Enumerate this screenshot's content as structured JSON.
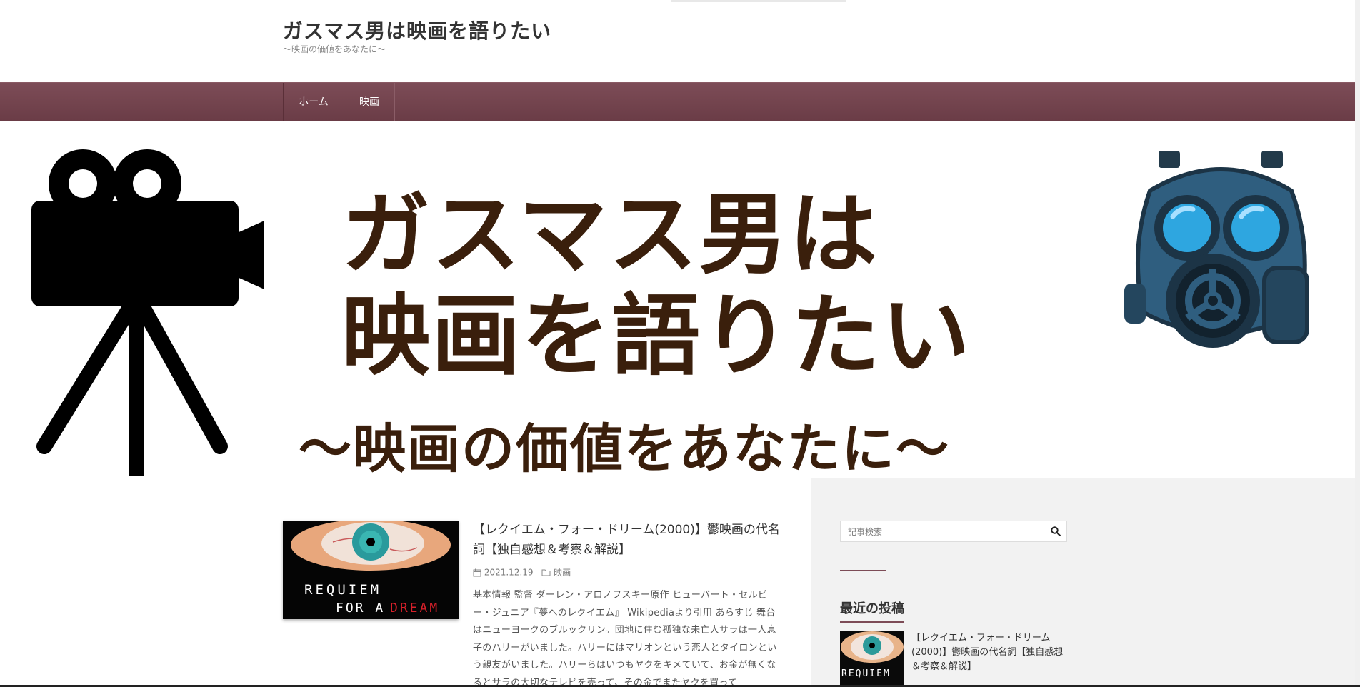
{
  "header": {
    "site_title": "ガスマス男は映画を語りたい",
    "site_description": "〜映画の価値をあなたに〜"
  },
  "nav": {
    "items": [
      {
        "label": "ホーム"
      },
      {
        "label": "映画"
      }
    ]
  },
  "hero": {
    "line1": "ガスマス男は",
    "line2": "映画を語りたい",
    "line3": "〜映画の価値をあなたに〜"
  },
  "article": {
    "title": "【レクイエム・フォー・ドリーム(2000)】鬱映画の代名詞【独自感想＆考察＆解説】",
    "date": "2021.12.19",
    "category": "映画",
    "excerpt": "基本情報 監督 ダーレン・アロノフスキー原作 ヒューバート・セルビー・ジュニア『夢へのレクイエム』 Wikipediaより引用 あらすじ 舞台はニューヨークのブルックリン。団地に住む孤独な未亡人サラは一人息子のハリーがいました。ハリーにはマリオンという恋人とタイロンという親友がいました。ハリーらはいつもヤクをキメていて、お金が無くなるとサラの大切なテレビを売って、その金でまたヤクを買って",
    "thumb_text_1": "REQUIEM",
    "thumb_text_2": "FOR A",
    "thumb_text_3": "DREAM"
  },
  "sidebar": {
    "search_placeholder": "記事検索",
    "recent_title": "最近の投稿",
    "recent_posts": [
      {
        "title": "【レクイエム・フォー・ドリーム(2000)】鬱映画の代名詞【独自感想＆考察＆解説】",
        "thumb_text": "REQUIEM"
      }
    ]
  },
  "colors": {
    "nav_bg": "#6f3f49",
    "hero_text": "#3a1f0c",
    "sidebar_bg": "#f2f2f2",
    "accent": "#7d4c57"
  },
  "icons": [
    "movie-camera-icon",
    "gas-mask-icon",
    "search-icon",
    "calendar-icon",
    "folder-icon"
  ]
}
